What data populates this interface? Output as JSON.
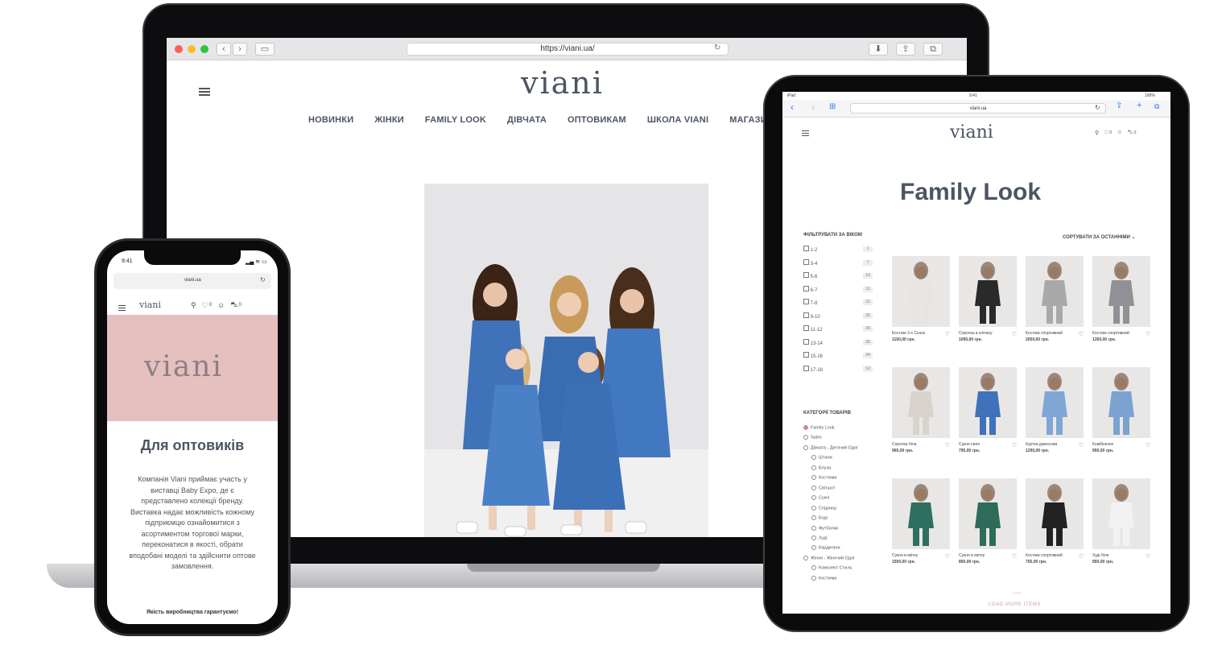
{
  "laptop": {
    "url": "https://viani.ua/",
    "logo": "viani",
    "nav": [
      "НОВИНКИ",
      "ЖІНКИ",
      "FAMILY LOOK",
      "ДІВЧАТА",
      "ОПТОВИКАМ",
      "ШКОЛА VIANI",
      "МАГАЗИ"
    ]
  },
  "tablet": {
    "status_time": "9:41",
    "status_left": "iPad",
    "status_right": "100%",
    "url": "viani.ua",
    "logo": "viani",
    "wishlist_count": "0",
    "cart_count": "0",
    "page_title": "Family Look",
    "filter_title": "ФІЛЬТРУВАТИ ЗА ВІКОМ",
    "sort_label": "СОРТУВАТИ ЗА ОСТАННІМИ",
    "age_filters": [
      {
        "label": "1-2",
        "count": "1"
      },
      {
        "label": "3-4",
        "count": "7"
      },
      {
        "label": "5-6",
        "count": "10"
      },
      {
        "label": "6-7",
        "count": "11"
      },
      {
        "label": "7-8",
        "count": "21"
      },
      {
        "label": "9-10",
        "count": "25"
      },
      {
        "label": "11-12",
        "count": "26"
      },
      {
        "label": "13-14",
        "count": "26"
      },
      {
        "label": "15-16",
        "count": "24"
      },
      {
        "label": "17-18",
        "count": "12"
      }
    ],
    "categories_title": "КАТЕГОРІЇ ТОВАРІВ",
    "categories": [
      "Family Look",
      "Sales",
      "Дівчата - Дитячий Одяг",
      "Штани",
      "Блуза",
      "Костюми",
      "Світшот",
      "Сукні",
      "Спідниці",
      "Боді",
      "Футболки",
      "Худі",
      "Кардигани",
      "Жінки - Жіночий Одяг",
      "Комплект Стиль",
      "Костюми"
    ],
    "products": [
      {
        "name": "Костюм 3-х Сезон",
        "price": "1150,00 грн."
      },
      {
        "name": "Сорочка в клітину",
        "price": "1090,00 грн."
      },
      {
        "name": "Костюм спортивний",
        "price": "2050,00 грн."
      },
      {
        "name": "Костюм спортивний",
        "price": "1350,00 грн."
      },
      {
        "name": "Сорочка біла",
        "price": "965,00 грн."
      },
      {
        "name": "Сукня синя",
        "price": "795,00 грн."
      },
      {
        "name": "Куртка джинсова",
        "price": "1290,00 грн."
      },
      {
        "name": "Комбінезон",
        "price": "950,00 грн."
      },
      {
        "name": "Сукня в квітку",
        "price": "1500,00 грн."
      },
      {
        "name": "Сукня в квітку",
        "price": "850,00 грн."
      },
      {
        "name": "Костюм спортивний",
        "price": "755,00 грн."
      },
      {
        "name": "Худі біле",
        "price": "850,00 грн."
      }
    ],
    "load_more": "LOAD MORE ITEMS"
  },
  "phone": {
    "status_time": "9:41",
    "url": "viani.ua",
    "logo": "viani",
    "wishlist_count": "0",
    "cart_count": "0",
    "hero_logo": "viani",
    "heading": "Для оптовиків",
    "body": "Компанія Viani приймає участь у виставці Baby Expo, де є представлено колекції бренду. Виставка надає можливість кожному підприємцю ознайомитися з асортиментом торгової марки, переконатися в якості, обрати вподобані моделі та здійснити оптове замовлення.",
    "footer_note": "Якість виробництва гарантуємо!"
  },
  "colors": {
    "accent": "#4c5565",
    "hero_pink": "#e6bfbf",
    "dress_blue": "#3f72b8",
    "backdrop": "#e5e5e7"
  }
}
